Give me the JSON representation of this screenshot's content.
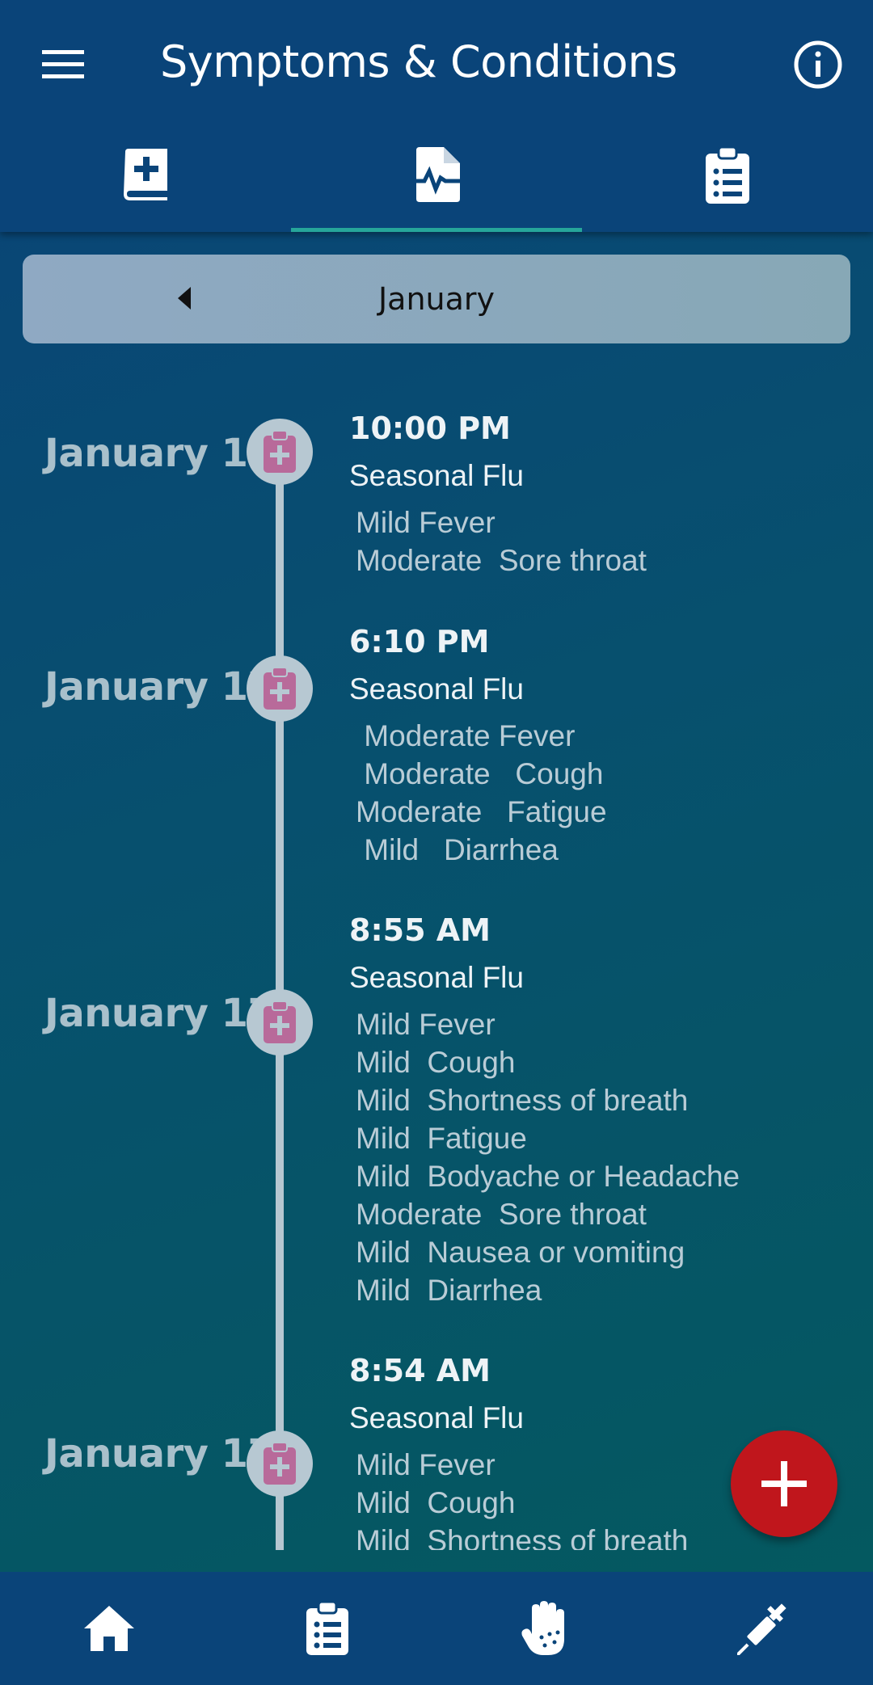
{
  "header": {
    "title": "Symptoms & Conditions"
  },
  "icons": {
    "menu": "menu-icon",
    "info": "info-icon",
    "tab_journal": "medical-book-icon",
    "tab_symptoms": "file-pulse-icon",
    "tab_list": "clipboard-list-icon",
    "prev_month": "caret-left-icon",
    "entry": "clipboard-medical-icon",
    "add": "plus-icon",
    "nav_home": "home-icon",
    "nav_clipboard": "clipboard-list-icon",
    "nav_hand": "hand-dots-icon",
    "nav_syringe": "syringe-icon"
  },
  "colors": {
    "fab": "#c0161c",
    "active_tab_indicator": "#26a69a",
    "node": "#b7c8d2",
    "node_icon": "#b86a9a"
  },
  "month_selector": {
    "label": "January"
  },
  "entries": [
    {
      "date": "January 18",
      "time": "10:00 PM",
      "condition": "Seasonal Flu",
      "symptoms": [
        "Mild Fever",
        "Moderate  Sore throat"
      ]
    },
    {
      "date": "January 17",
      "time": "6:10 PM",
      "condition": "Seasonal Flu",
      "symptoms": [
        " Moderate Fever",
        " Moderate   Cough",
        "Moderate   Fatigue",
        " Mild   Diarrhea"
      ]
    },
    {
      "date": "January 17",
      "time": "8:55 AM",
      "condition": "Seasonal Flu",
      "symptoms": [
        "Mild Fever",
        "Mild  Cough",
        "Mild  Shortness of breath",
        "Mild  Fatigue",
        "Mild  Bodyache or Headache",
        "Moderate  Sore throat",
        "Mild  Nausea or vomiting",
        "Mild  Diarrhea"
      ]
    },
    {
      "date": "January 17",
      "time": "8:54 AM",
      "condition": "Seasonal Flu",
      "symptoms": [
        "Mild Fever",
        "Mild  Cough",
        "Mild  Shortness of breath"
      ]
    }
  ]
}
